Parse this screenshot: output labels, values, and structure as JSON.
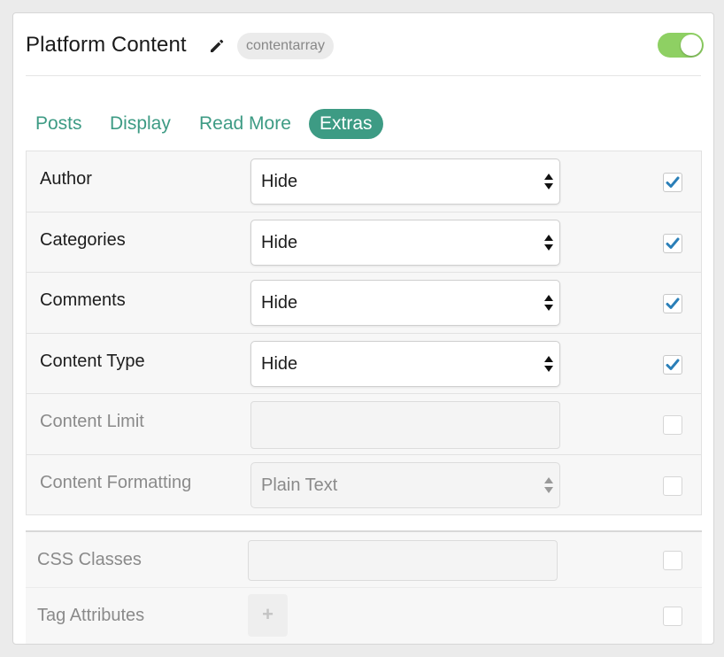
{
  "header": {
    "title": "Platform Content",
    "slug": "contentarray",
    "edit_icon": "pencil-icon",
    "enabled": true,
    "toggle_color": "#8ed063"
  },
  "tabs": [
    {
      "label": "Posts",
      "active": false
    },
    {
      "label": "Display",
      "active": false
    },
    {
      "label": "Read More",
      "active": false
    },
    {
      "label": "Extras",
      "active": true
    }
  ],
  "accent_color": "#3d9b84",
  "rows": [
    {
      "label": "Author",
      "control": "select",
      "value": "Hide",
      "checked": true,
      "disabled": false
    },
    {
      "label": "Categories",
      "control": "select",
      "value": "Hide",
      "checked": true,
      "disabled": false
    },
    {
      "label": "Comments",
      "control": "select",
      "value": "Hide",
      "checked": true,
      "disabled": false
    },
    {
      "label": "Content Type",
      "control": "select",
      "value": "Hide",
      "checked": true,
      "disabled": false
    },
    {
      "label": "Content Limit",
      "control": "text",
      "value": "",
      "checked": false,
      "disabled": true
    },
    {
      "label": "Content Formatting",
      "control": "select",
      "value": "Plain Text",
      "checked": false,
      "disabled": true
    }
  ],
  "sub_rows": [
    {
      "label": "CSS Classes",
      "control": "text",
      "value": "",
      "checked": false
    },
    {
      "label": "Tag Attributes",
      "control": "add",
      "button_label": "+",
      "checked": false
    }
  ]
}
